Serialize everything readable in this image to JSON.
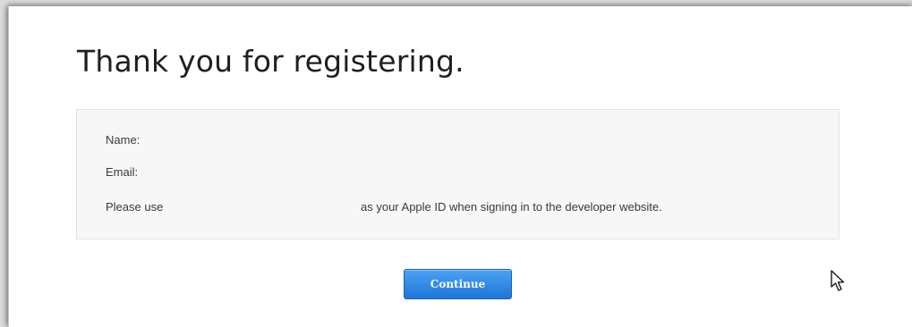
{
  "page": {
    "title": "Thank you for registering."
  },
  "info": {
    "name_label": "Name:",
    "email_label": "Email:",
    "appleid_prefix": "Please use",
    "appleid_suffix": "as your Apple ID when signing in to the developer website."
  },
  "actions": {
    "continue_label": "Continue"
  },
  "icons": {
    "cursor": "mouse-pointer-icon"
  },
  "colors": {
    "button_top": "#4aa3f3",
    "button_bottom": "#1f75d8",
    "box_background": "#f7f7f7"
  }
}
